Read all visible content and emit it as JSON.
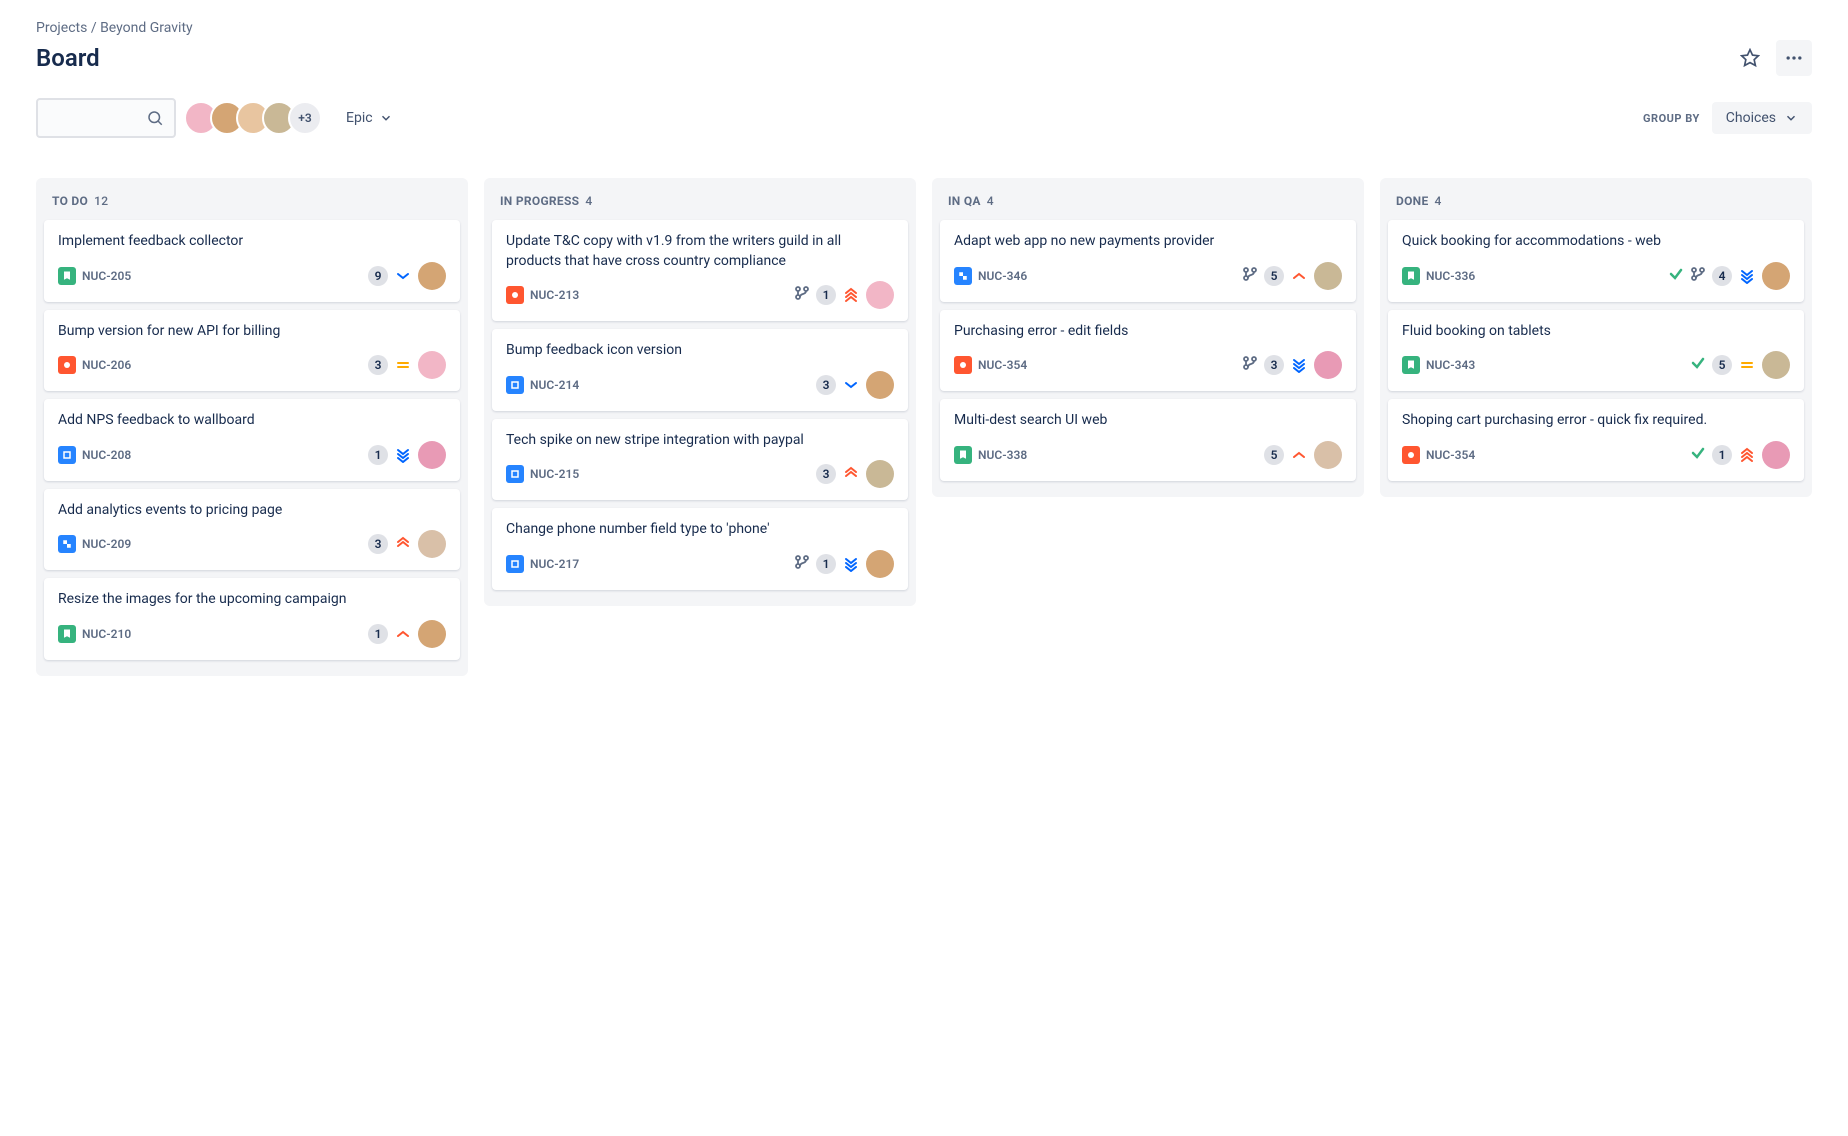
{
  "breadcrumb": {
    "root": "Projects",
    "project": "Beyond Gravity"
  },
  "page_title": "Board",
  "avatars_overflow": "+3",
  "filter_label": "Epic",
  "group_by_label": "GROUP BY",
  "group_by_value": "Choices",
  "avatar_colors": [
    "#f2b6c6",
    "#d4a574",
    "#e8c5a0",
    "#c9b896"
  ],
  "columns": [
    {
      "name": "TO DO",
      "count": "12",
      "cards": [
        {
          "title": "Implement feedback collector",
          "type": "story",
          "key": "NUC-205",
          "count": "9",
          "priority": "low",
          "avatar": "#d4a574"
        },
        {
          "title": "Bump version for new API for billing",
          "type": "bug",
          "key": "NUC-206",
          "count": "3",
          "priority": "medium",
          "avatar": "#f2b6c6"
        },
        {
          "title": "Add NPS feedback to wallboard",
          "type": "task",
          "key": "NUC-208",
          "count": "1",
          "priority": "lowest",
          "avatar": "#e89ab5"
        },
        {
          "title": "Add analytics events to pricing page",
          "type": "subtask",
          "key": "NUC-209",
          "count": "3",
          "priority": "high",
          "avatar": "#d9c0a8"
        },
        {
          "title": "Resize the images for the upcoming campaign",
          "type": "story",
          "key": "NUC-210",
          "count": "1",
          "priority": "up",
          "avatar": "#d4a574"
        }
      ]
    },
    {
      "name": "IN PROGRESS",
      "count": "4",
      "cards": [
        {
          "title": "Update T&C copy with v1.9 from the writers guild in all products that have cross country compliance",
          "type": "bug",
          "key": "NUC-213",
          "branch": true,
          "count": "1",
          "priority": "highest",
          "avatar": "#f2b6c6"
        },
        {
          "title": "Bump feedback icon version",
          "type": "task",
          "key": "NUC-214",
          "count": "3",
          "priority": "low",
          "avatar": "#d4a574"
        },
        {
          "title": "Tech spike on new stripe integration with paypal",
          "type": "task",
          "key": "NUC-215",
          "count": "3",
          "priority": "high",
          "avatar": "#c9b896"
        },
        {
          "title": "Change phone number field type to 'phone'",
          "type": "task",
          "key": "NUC-217",
          "branch": true,
          "count": "1",
          "priority": "lowest",
          "avatar": "#d4a574"
        }
      ]
    },
    {
      "name": "IN QA",
      "count": "4",
      "cards": [
        {
          "title": "Adapt web app no new payments provider",
          "type": "subtask",
          "key": "NUC-346",
          "branch": true,
          "count": "5",
          "priority": "up",
          "avatar": "#c9b896"
        },
        {
          "title": "Purchasing error - edit fields",
          "type": "bug",
          "key": "NUC-354",
          "branch": true,
          "count": "3",
          "priority": "lowest",
          "avatar": "#e89ab5"
        },
        {
          "title": "Multi-dest search UI web",
          "type": "story",
          "key": "NUC-338",
          "count": "5",
          "priority": "up",
          "avatar": "#d9c0a8"
        }
      ]
    },
    {
      "name": "DONE",
      "count": "4",
      "cards": [
        {
          "title": "Quick booking for accommodations - web",
          "type": "story",
          "key": "NUC-336",
          "check": true,
          "branch": true,
          "count": "4",
          "priority": "lowest",
          "avatar": "#d4a574"
        },
        {
          "title": "Fluid booking on tablets",
          "type": "story",
          "key": "NUC-343",
          "check": true,
          "count": "5",
          "priority": "medium",
          "avatar": "#c9b896"
        },
        {
          "title": "Shoping cart purchasing error - quick fix required.",
          "type": "bug",
          "key": "NUC-354",
          "check": true,
          "count": "1",
          "priority": "highest",
          "avatar": "#e89ab5"
        }
      ]
    }
  ]
}
